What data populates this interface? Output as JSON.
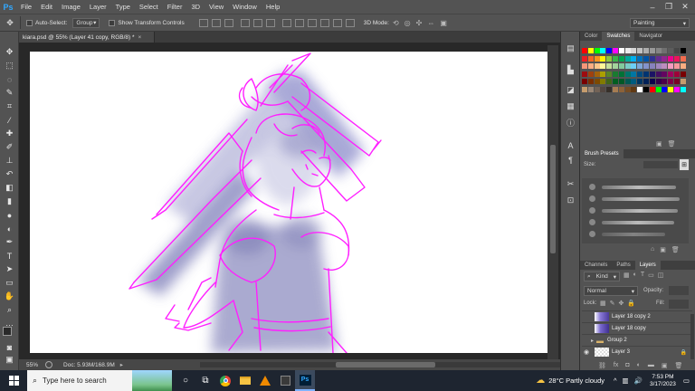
{
  "app": {
    "logo": "Ps"
  },
  "menu": [
    "File",
    "Edit",
    "Image",
    "Layer",
    "Type",
    "Select",
    "Filter",
    "3D",
    "View",
    "Window",
    "Help"
  ],
  "window_controls": [
    "–",
    "❐",
    "✕"
  ],
  "options": {
    "auto_select_label": "Auto-Select:",
    "auto_select_value": "Group",
    "show_transform_label": "Show Transform Controls",
    "mode_3d_label": "3D Mode:",
    "workspace": "Painting"
  },
  "document": {
    "tab_title": "kiara.psd @ 55% (Layer 41 copy, RGB/8) *",
    "tab_close": "×"
  },
  "status": {
    "zoom": "55%",
    "doc_size": "Doc: 5.93M/168.9M"
  },
  "panels": {
    "top_tabs": [
      "Color",
      "Swatches",
      "Navigator"
    ],
    "top_active": "Swatches",
    "brush_presets_title": "Brush Presets",
    "size_label": "Size:",
    "layer_tabs": [
      "Channels",
      "Paths",
      "Layers"
    ],
    "layers_active": "Layers",
    "kind_label": "Kind",
    "blend_mode": "Normal",
    "opacity_label": "Opacity:",
    "lock_label": "Lock:",
    "fill_label": "Fill:",
    "layers": [
      {
        "name": "Layer 18 copy 2",
        "type": "layer",
        "visible": false
      },
      {
        "name": "Layer 18 copy",
        "type": "layer",
        "visible": false
      },
      {
        "name": "Group 2",
        "type": "group",
        "visible": false
      },
      {
        "name": "Layer 3",
        "type": "layer",
        "visible": true,
        "locked": true
      }
    ],
    "swatch_colors": [
      [
        "#ff0000",
        "#ffff00",
        "#00ff00",
        "#00ffff",
        "#0000ff",
        "#ff00ff",
        "#ffffff",
        "#ebebeb",
        "#d6d6d6",
        "#c2c2c2",
        "#adadad",
        "#999999",
        "#858585",
        "#707070",
        "#5c5c5c",
        "#474747",
        "#000000"
      ],
      [
        "#ed1c24",
        "#f26522",
        "#f7941d",
        "#fff200",
        "#8dc63f",
        "#39b54a",
        "#00a651",
        "#00a99d",
        "#00aeef",
        "#0072bc",
        "#0054a6",
        "#2e3192",
        "#662d91",
        "#92278f",
        "#ec008c",
        "#ed145b",
        "#f26c4f"
      ],
      [
        "#f69679",
        "#fbad82",
        "#fdc68a",
        "#fff799",
        "#c4df9b",
        "#a3d39c",
        "#82ca9d",
        "#7accc8",
        "#6dcff6",
        "#7da7d9",
        "#8393ca",
        "#8781bd",
        "#a186be",
        "#bd8cbf",
        "#f49ac1",
        "#f5989d",
        "#f9ad81"
      ],
      [
        "#9e0b0f",
        "#a0410d",
        "#a3620a",
        "#aba000",
        "#598527",
        "#1a7b30",
        "#007236",
        "#00746b",
        "#0076a3",
        "#004b80",
        "#003471",
        "#1b1464",
        "#440e62",
        "#630460",
        "#9e005d",
        "#9e0039",
        "#790000"
      ],
      [
        "#790000",
        "#7b2e00",
        "#7d4900",
        "#827b00",
        "#406618",
        "#005e20",
        "#005826",
        "#005952",
        "#005b7f",
        "#003663",
        "#002157",
        "#0d004c",
        "#32004b",
        "#4b0049",
        "#7b0046",
        "#7a0026",
        "#c69c6d"
      ],
      [
        "#c69c6d",
        "#998675",
        "#736357",
        "#534741",
        "#37302a",
        "#a67c52",
        "#8c6239",
        "#754c24",
        "#603913",
        "#ffffff",
        "#000000",
        "#ff0000",
        "#00ff00",
        "#0000ff",
        "#ffff00",
        "#ff00ff",
        "#00ffff"
      ]
    ]
  },
  "taskbar": {
    "search_placeholder": "Type here to search",
    "weather": "28°C  Partly cloudy",
    "time": "7:53 PM",
    "date": "3/17/2023"
  }
}
